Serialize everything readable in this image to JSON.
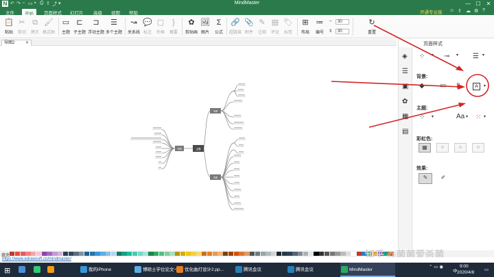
{
  "window": {
    "app_title": "MindMaster",
    "logo_letter": "N",
    "upgrade_label": "开通专业版",
    "controls": {
      "min": "—",
      "max": "☐",
      "close": "✕"
    }
  },
  "menu": {
    "tabs": [
      "文件",
      "开始",
      "页面样式",
      "幻灯片",
      "高级",
      "视图",
      "帮助"
    ],
    "active_tab": "开始"
  },
  "ribbon": {
    "paste": "粘贴",
    "cut": "剪切",
    "copy": "拷贝",
    "format_painter": "格式刷",
    "topic": "主题",
    "subtopic": "子主题",
    "floating_topic": "浮动主题",
    "multi_topic": "多个主题",
    "relationship": "关系线",
    "callout": "标注",
    "outline_box": "外框",
    "summary": "概要",
    "clipart": "剪贴画",
    "image": "图片",
    "formula": "公式",
    "hyperlink": "超链接",
    "attachment": "附件",
    "note": "注释",
    "comment": "评论",
    "tag": "标签",
    "layout": "布局",
    "numbering": "编号",
    "spacing_h": "30",
    "spacing_v": "30",
    "reset": "重置"
  },
  "document": {
    "tab_name": "导图2",
    "close": "✕"
  },
  "mindmap": {
    "center": "主题",
    "left_main": "主题",
    "right_top": "主题",
    "right_bottom": "主题"
  },
  "right_panel": {
    "title": "页面样式",
    "background_label": "背景:",
    "theme_label": "主题:",
    "rainbow_label": "彩虹色:",
    "effect_label": "效果:",
    "font_label": "Aa"
  },
  "palette": {
    "fill_label": "填充",
    "colors": [
      "#c0392b",
      "#e74c3c",
      "#e05a6a",
      "#f08080",
      "#f4a6b0",
      "#f7c6cf",
      "#8e44ad",
      "#a569bd",
      "#c39bd3",
      "#d2b4de",
      "#2c3e50",
      "#34495e",
      "#5d6d7e",
      "#85929e",
      "#1f618d",
      "#2874a6",
      "#3498db",
      "#5dade2",
      "#85c1e9",
      "#aed6f1",
      "#117a65",
      "#16a085",
      "#1abc9c",
      "#48c9b0",
      "#76d7c4",
      "#a3e4d7",
      "#1e8449",
      "#27ae60",
      "#52be80",
      "#7dcea0",
      "#a9dfbf",
      "#b7950b",
      "#d4ac0d",
      "#f1c40f",
      "#f4d03f",
      "#f7dc6f",
      "#ca6f1e",
      "#e67e22",
      "#eb984e",
      "#f0b27a",
      "#784212",
      "#a04000",
      "#d35400",
      "#dc7633",
      "#e59866",
      "#4d5656",
      "#707b7c",
      "#95a5a6",
      "#b2babb",
      "#d0d3d4",
      "#1b2631",
      "#283747",
      "#2e4053",
      "#566573",
      "#808b96",
      "#abb2b9",
      "#e5e8e8",
      "#000000",
      "#333333",
      "#555555",
      "#777777",
      "#999999",
      "#bbbbbb",
      "#dddddd",
      "#ffffff",
      "#c0392b",
      "#2980b9",
      "#27ae60",
      "#f39c12",
      "#8e44ad",
      "#16a085",
      "#d35400"
    ]
  },
  "status": {
    "url": "https://www.edrawsoft.cn/mindmaster/"
  },
  "watermark": "知乎 @菌菌爱杀菌",
  "taskbar": {
    "items": [
      {
        "label": "",
        "color": "#4a90d9"
      },
      {
        "label": "",
        "color": "#2ecc71"
      },
      {
        "label": "",
        "color": "#f39c12"
      },
      {
        "label": "我的iPhone",
        "color": "#3498db"
      },
      {
        "label": "博硕士学位论文一...",
        "color": "#5dade2"
      },
      {
        "label": "优化曲灯设计2.pp...",
        "color": "#e67e22"
      },
      {
        "label": "腾讯会议",
        "color": "#2980b9"
      },
      {
        "label": "腾讯会议",
        "color": "#2980b9"
      },
      {
        "label": "",
        "color": "#c0392b"
      },
      {
        "label": "MindMaster",
        "color": "#27ae60"
      }
    ],
    "time": "9:00",
    "date": "2020/4/8",
    "lang": "中"
  }
}
